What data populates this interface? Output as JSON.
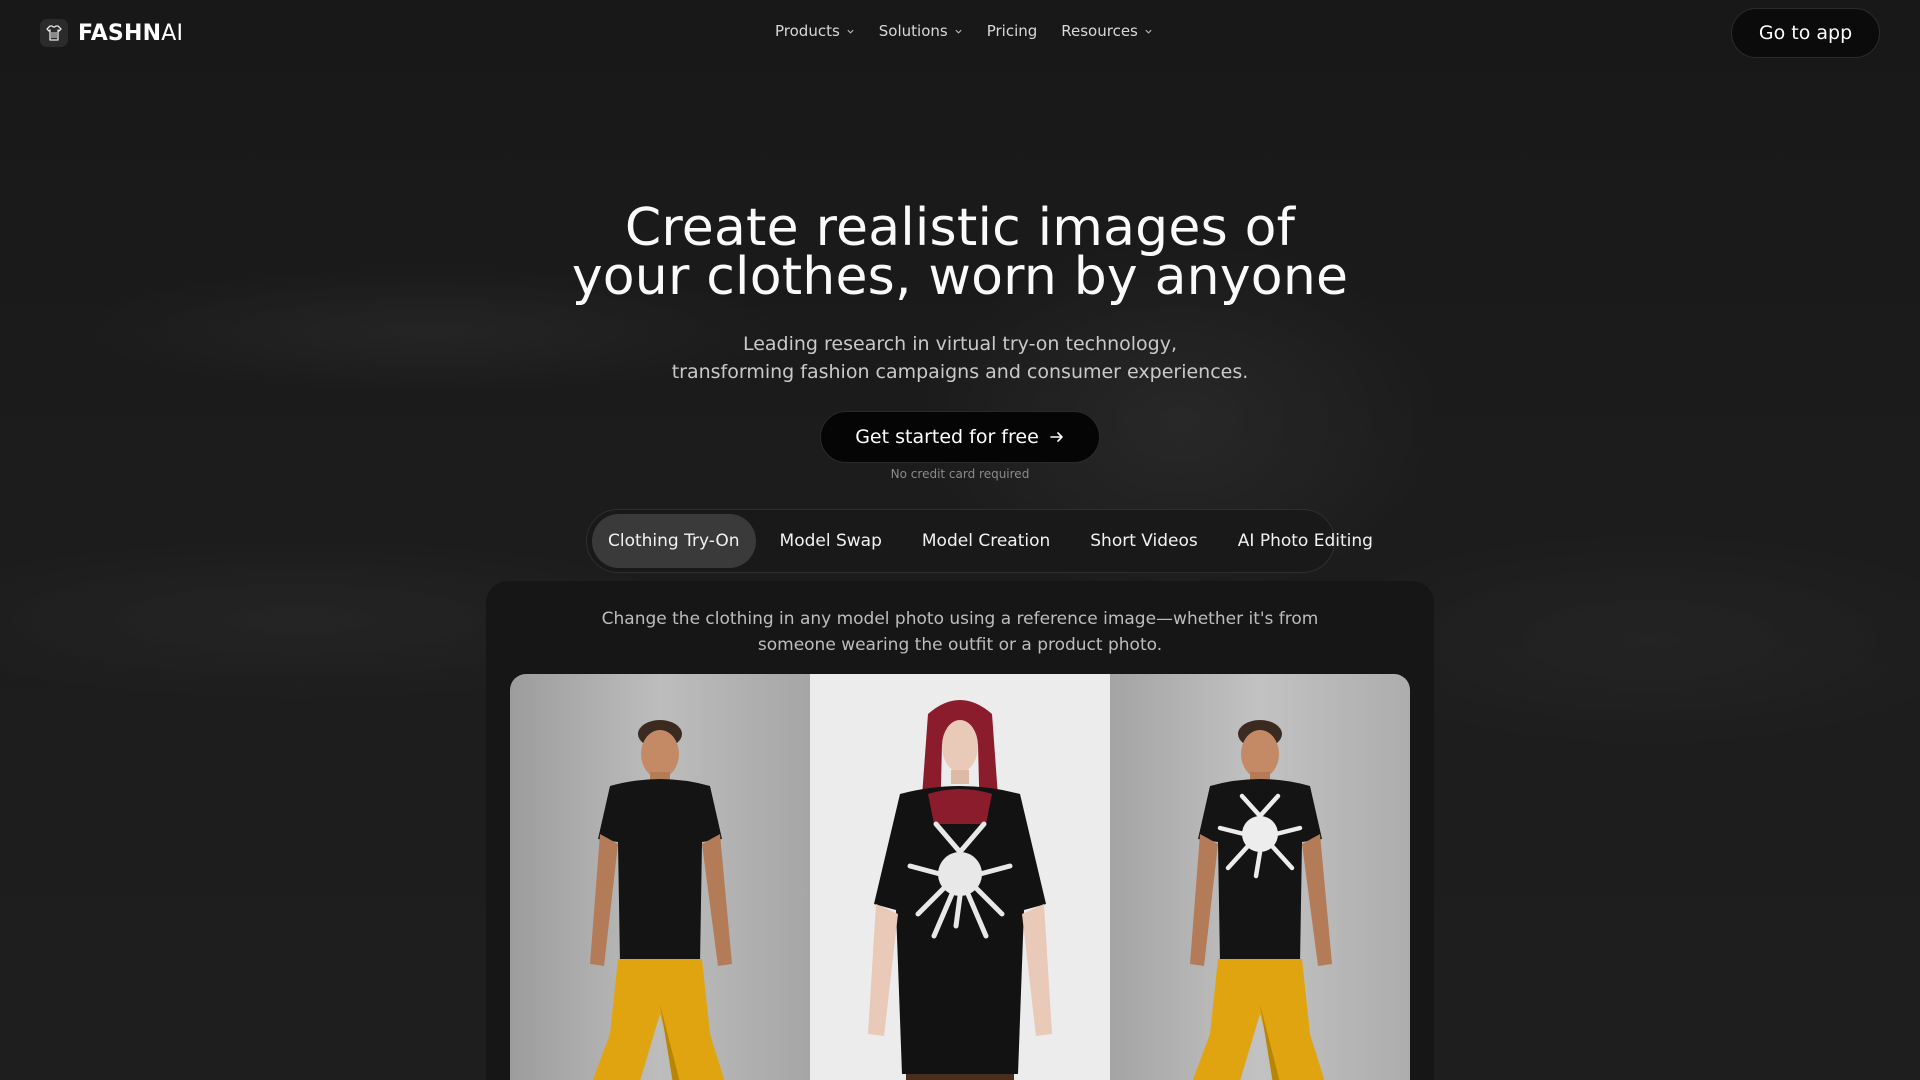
{
  "header": {
    "logo": {
      "bold": "FASHN",
      "light": "AI"
    },
    "nav": [
      {
        "label": "Products",
        "dropdown": true
      },
      {
        "label": "Solutions",
        "dropdown": true
      },
      {
        "label": "Pricing",
        "dropdown": false
      },
      {
        "label": "Resources",
        "dropdown": true
      }
    ],
    "go_to_app": "Go to app"
  },
  "hero": {
    "title_line1": "Create realistic images of",
    "title_line2": "your clothes, worn by anyone",
    "subtitle_line1": "Leading research in virtual try-on technology,",
    "subtitle_line2": "transforming fashion campaigns and consumer experiences.",
    "cta_label": "Get started for free",
    "cta_note": "No credit card required"
  },
  "tabs": {
    "items": [
      "Clothing Try-On",
      "Model Swap",
      "Model Creation",
      "Short Videos",
      "AI Photo Editing"
    ],
    "active": "Clothing Try-On"
  },
  "panel": {
    "description_line1": "Change the clothing in any model photo using a reference image—whether it's from",
    "description_line2": "someone wearing the outfit or a product photo."
  },
  "colors": {
    "background": "#1b1b1b",
    "button": "#050505",
    "active_tab": "#3a3a3a",
    "pants": "#e0a410",
    "tshirt": "#121212",
    "hair": "#8a1c2c"
  }
}
